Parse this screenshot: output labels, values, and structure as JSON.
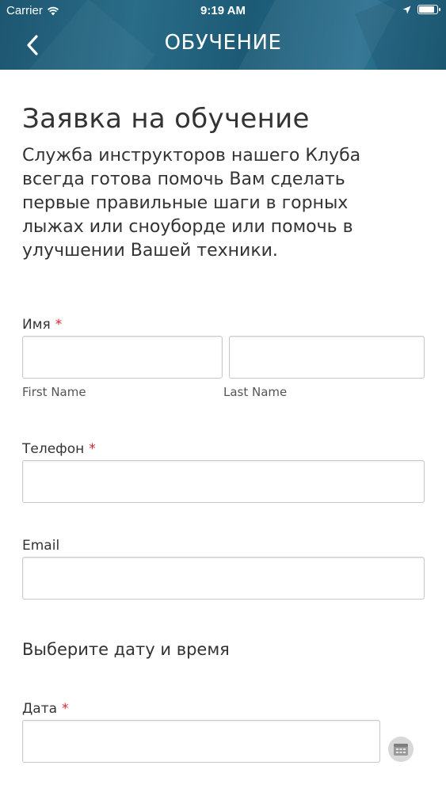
{
  "status_bar": {
    "carrier": "Carrier",
    "time": "9:19 AM"
  },
  "nav": {
    "title": "ОБУЧЕНИЕ",
    "back_icon": "chevron-left-icon"
  },
  "form": {
    "heading": "Заявка на обучение",
    "intro": "Служба инструкторов нашего Клуба всегда готова помочь Вам сделать первые правильные шаги в горных лыжах или сноуборде или помочь в улучшении Вашей техники.",
    "name": {
      "label": "Имя",
      "required_mark": "*",
      "first_value": "",
      "last_value": "",
      "first_sublabel": "First Name",
      "last_sublabel": "Last Name"
    },
    "phone": {
      "label": "Телефон",
      "required_mark": "*",
      "value": ""
    },
    "email": {
      "label": "Email",
      "value": ""
    },
    "datetime_section": "Выберите дату и время",
    "date": {
      "label": "Дата",
      "required_mark": "*",
      "value": "",
      "picker_icon": "calendar-icon"
    }
  },
  "colors": {
    "header_bg": "#245f7b",
    "required": "#d9242b",
    "text": "#333333"
  }
}
